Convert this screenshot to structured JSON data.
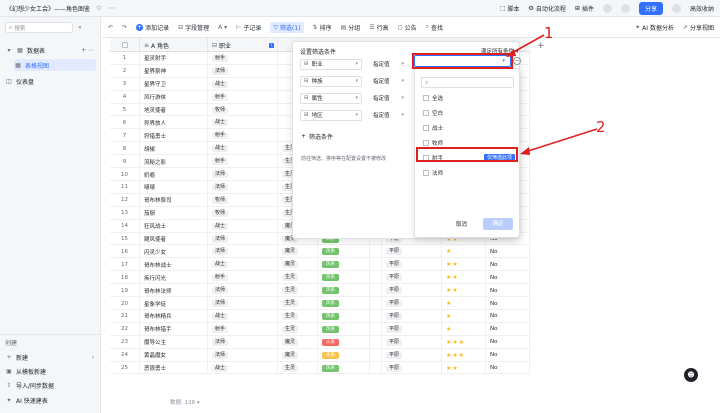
{
  "window": {
    "doc_title": "《幻想少女工会》——角色图鉴",
    "toolbar_right": [
      "脚本",
      "自动化流程",
      "插件"
    ],
    "share_label": "分享",
    "user_label": "高效收纳"
  },
  "sidebar": {
    "search_placeholder": "搜索",
    "items": [
      {
        "label": "数据表"
      },
      {
        "label": "表格视图"
      },
      {
        "label": "仪表盘"
      }
    ],
    "bottom": [
      {
        "label": "创建"
      },
      {
        "label": "新建"
      },
      {
        "label": "从模板新建"
      },
      {
        "label": "导入/同步数据"
      },
      {
        "label": "AI 快速建表"
      }
    ]
  },
  "toolbar": {
    "items": [
      "添加记录",
      "字段管理",
      "子记录",
      "筛选(1)",
      "排序",
      "分组",
      "行高",
      "公告",
      "查找"
    ],
    "right": [
      "AI 数据分析",
      "分享视图"
    ]
  },
  "columns": [
    "A 角色",
    "职业",
    "职业",
    "模式",
    "属性",
    "地区",
    "星级",
    "状态"
  ],
  "rows": [
    {
      "n": "1",
      "name": "星灵射手",
      "job": "射手",
      "race": "",
      "mode": "",
      "attr": "",
      "region": "",
      "stars": 0,
      "status": ""
    },
    {
      "n": "2",
      "name": "星界祭神",
      "job": "法师",
      "race": "",
      "mode": "",
      "attr": "",
      "region": "",
      "stars": 0,
      "status": ""
    },
    {
      "n": "3",
      "name": "星界守卫",
      "job": "战士",
      "race": "",
      "mode": "",
      "attr": "",
      "region": "",
      "stars": 0,
      "status": ""
    },
    {
      "n": "4",
      "name": "风行游侠",
      "job": "射手",
      "race": "",
      "mode": "",
      "attr": "",
      "region": "",
      "stars": 0,
      "status": ""
    },
    {
      "n": "5",
      "name": "地灵使者",
      "job": "牧师",
      "race": "",
      "mode": "",
      "attr": "",
      "region": "",
      "stars": 0,
      "status": ""
    },
    {
      "n": "6",
      "name": "异界旅人",
      "job": "战士",
      "race": "",
      "mode": "",
      "attr": "",
      "region": "",
      "stars": 0,
      "status": ""
    },
    {
      "n": "7",
      "name": "狩猎勇士",
      "job": "射手",
      "race": "",
      "mode": "",
      "attr": "",
      "region": "",
      "stars": 0,
      "status": ""
    },
    {
      "n": "8",
      "name": "胡椒",
      "job": "战士",
      "race": "生灵",
      "mode": "",
      "attr": "",
      "region": "",
      "stars": 0,
      "status": ""
    },
    {
      "n": "9",
      "name": "流秘之影",
      "job": "射手",
      "race": "生灵",
      "mode": "暗系",
      "attr": "",
      "region": "平原",
      "stars": 0,
      "status": ""
    },
    {
      "n": "10",
      "name": "奶瘾",
      "job": "法师",
      "race": "生灵",
      "mode": "火系",
      "attr": "",
      "region": "平原",
      "stars": 0,
      "status": ""
    },
    {
      "n": "11",
      "name": "啵啵",
      "job": "法师",
      "race": "生灵",
      "mode": "光系",
      "attr": "",
      "region": "平原",
      "stars": 0,
      "status": ""
    },
    {
      "n": "12",
      "name": "哥布林祭司",
      "job": "牧师",
      "race": "生灵",
      "mode": "风系",
      "attr": "",
      "region": "平原",
      "stars": 0,
      "status": ""
    },
    {
      "n": "13",
      "name": "茄厨",
      "job": "牧师",
      "race": "生灵",
      "mode": "风系",
      "attr": "",
      "region": "平原",
      "stars": 0,
      "status": ""
    },
    {
      "n": "14",
      "name": "狂风战士",
      "job": "战士",
      "race": "魔灵",
      "mode": "风系",
      "attr": "",
      "region": "平原",
      "stars": 0,
      "status": ""
    },
    {
      "n": "15",
      "name": "飓风使者",
      "job": "法师",
      "race": "魔灵",
      "mode": "风系",
      "attr": "",
      "region": "平原",
      "stars": 2,
      "status": "No"
    },
    {
      "n": "16",
      "name": "闪灵少女",
      "job": "法师",
      "race": "魔灵",
      "mode": "风系",
      "attr": "",
      "region": "平原",
      "stars": 1,
      "status": "No"
    },
    {
      "n": "17",
      "name": "哥布林战士",
      "job": "战士",
      "race": "魔灵",
      "mode": "风系",
      "attr": "",
      "region": "平原",
      "stars": 2,
      "status": "No"
    },
    {
      "n": "18",
      "name": "疾行闪光",
      "job": "射手",
      "race": "生灵",
      "mode": "风系",
      "attr": "",
      "region": "平原",
      "stars": 2,
      "status": "No"
    },
    {
      "n": "19",
      "name": "哥布林法师",
      "job": "法师",
      "race": "生灵",
      "mode": "风系",
      "attr": "",
      "region": "平原",
      "stars": 2,
      "status": "No"
    },
    {
      "n": "20",
      "name": "星象学徒",
      "job": "法师",
      "race": "生灵",
      "mode": "风系",
      "attr": "",
      "region": "平原",
      "stars": 1,
      "status": "No"
    },
    {
      "n": "21",
      "name": "哥布林精兵",
      "job": "战士",
      "race": "生灵",
      "mode": "风系",
      "attr": "",
      "region": "平原",
      "stars": 1,
      "status": "No"
    },
    {
      "n": "22",
      "name": "哥布林猎手",
      "job": "射手",
      "race": "生灵",
      "mode": "风系",
      "attr": "",
      "region": "平原",
      "stars": 1,
      "status": "No"
    },
    {
      "n": "23",
      "name": "魔导公主",
      "job": "法师",
      "race": "魔灵",
      "mode": "火系",
      "attr": "",
      "region": "平原",
      "stars": 3,
      "status": "No"
    },
    {
      "n": "24",
      "name": "黄晶魔女",
      "job": "法师",
      "race": "魔灵",
      "mode": "光系",
      "attr": "",
      "region": "平原",
      "stars": 3,
      "status": "No"
    },
    {
      "n": "25",
      "name": "恶狼勇士",
      "job": "战士",
      "race": "生灵",
      "mode": "风系",
      "attr": "",
      "region": "平原",
      "stars": 2,
      "status": "No"
    }
  ],
  "footer": {
    "count": "数据: 128 ▾"
  },
  "filter_panel": {
    "title": "设置筛选条件",
    "all_label": "满足所有条件 ▾",
    "conditions": [
      {
        "field": "职业",
        "op": "指定值"
      },
      {
        "field": "种族",
        "op": "指定值"
      },
      {
        "field": "属性",
        "op": "指定值"
      },
      {
        "field": "地区",
        "op": "指定值"
      }
    ],
    "add_label": "筛选条件",
    "note": "前往筛选、排序等在配置设置不被修改"
  },
  "value_dropdown": {
    "options": [
      "全选",
      "空白",
      "战士",
      "牧师",
      "射手",
      "法师"
    ],
    "only_label": "仅筛选此项",
    "cancel": "取消",
    "ok": "确定"
  },
  "annotations": {
    "one": "1",
    "two": "2"
  },
  "colors": {
    "accent": "#3370ff",
    "annotation": "#e02020",
    "mode": {
      "暗系": "#e8684a",
      "火系": "#f76964",
      "光系": "#f8c44d",
      "风系": "#72c36c"
    }
  }
}
